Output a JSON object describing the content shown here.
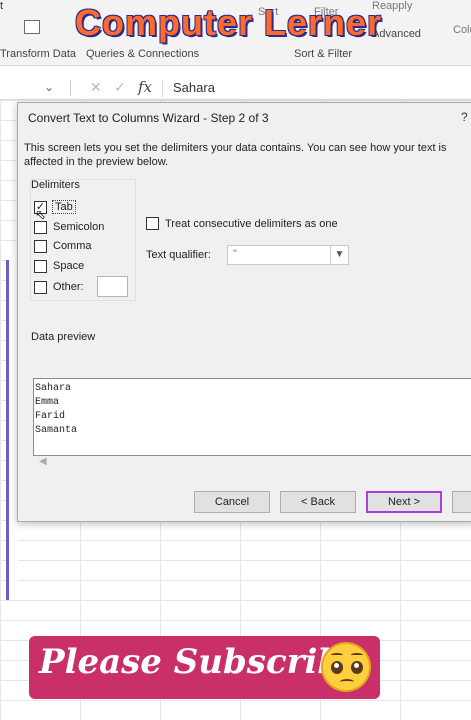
{
  "ribbon": {
    "top_fragment": "t",
    "brand": "Computer Lerner",
    "group_transform": "Transform Data",
    "group_queries": "Queries & Connections",
    "group_sort_filter": "Sort & Filter",
    "sort_label": "Sort",
    "filter_label": "Filter",
    "reapply_label": "Reapply",
    "advanced_label": "Advanced",
    "right_fragment": "Colu"
  },
  "formula_bar": {
    "fx": "fx",
    "value": "Sahara"
  },
  "dialog": {
    "title": "Convert Text to Columns Wizard - Step 2 of 3",
    "help": "?",
    "description": "This screen lets you set the delimiters your data contains.  You can see how your text is affected in the preview below.",
    "delimiters_title": "Delimiters",
    "delimiters": [
      {
        "label": "Tab",
        "checked": true
      },
      {
        "label": "Semicolon",
        "checked": false
      },
      {
        "label": "Comma",
        "checked": false
      },
      {
        "label": "Space",
        "checked": false
      },
      {
        "label": "Other:",
        "checked": false
      }
    ],
    "consecutive_label": "Treat consecutive delimiters as one",
    "consecutive_checked": false,
    "qualifier_label": "Text qualifier:",
    "qualifier_value": "\"",
    "preview_label": "Data preview",
    "preview_lines": [
      "Sahara",
      "Emma",
      "Farid",
      "Samanta"
    ],
    "buttons": {
      "cancel": "Cancel",
      "back": "< Back",
      "next": "Next >"
    }
  },
  "overlay": {
    "subscribe_text": "Please Subscribe",
    "emoji": "pleading-face-icon"
  },
  "colors": {
    "brand_orange": "#ff6a2b",
    "subscribe_bg": "#c9306a",
    "next_focus": "#a83de0"
  }
}
